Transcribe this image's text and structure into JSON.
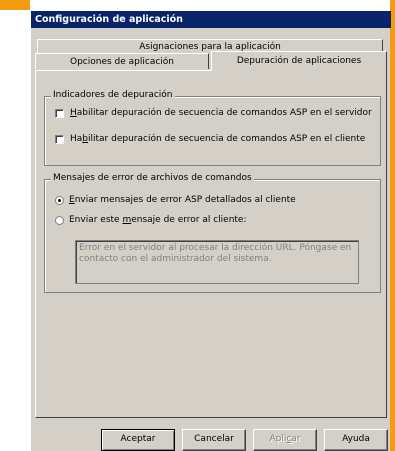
{
  "window": {
    "title": "Configuración de aplicación"
  },
  "tabs": {
    "row1": [
      "Asignaciones para la aplicación"
    ],
    "row2": [
      "Opciones de aplicación",
      "Depuración de aplicaciones"
    ],
    "active": "Depuración de aplicaciones"
  },
  "debug_flags": {
    "group_title": "Indicadores de depuración",
    "server_debug": {
      "pre": "",
      "key": "H",
      "post": "abilitar depuración de secuencia de comandos ASP en el servidor",
      "checked": false
    },
    "client_debug": {
      "pre": "Ha",
      "key": "b",
      "post": "ilitar depuración de secuencia de comandos ASP en el cliente",
      "checked": false
    }
  },
  "error_messages": {
    "group_title": "Mensajes de error de archivos de comandos",
    "option_detailed": {
      "pre": "",
      "key": "E",
      "post": "nviar mensajes de error ASP detallados al cliente",
      "selected": true
    },
    "option_custom": {
      "pre": "Enviar este ",
      "key": "m",
      "post": "ensaje de error al cliente:",
      "selected": false
    },
    "custom_text": "Error en el servidor al procesar la dirección URL. Póngase en contacto con el administrador del sistema."
  },
  "buttons": {
    "ok": "Aceptar",
    "cancel": "Cancelar",
    "apply_pre": "Apli",
    "apply_key": "c",
    "apply_post": "ar",
    "help": "Ayuda"
  },
  "colors": {
    "accent": "#f39c12",
    "titlebar": "#0a246a",
    "face": "#d4d0c8"
  }
}
